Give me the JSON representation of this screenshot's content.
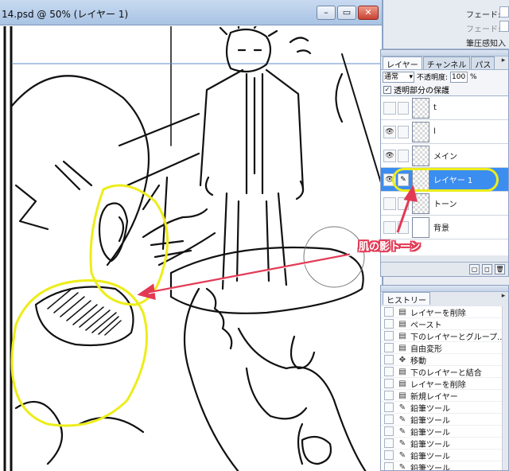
{
  "document": {
    "title": "14.psd @ 50% (レイヤー 1)",
    "buttons": {
      "minimize": "–",
      "restore": "▭",
      "close": "✕"
    }
  },
  "topright": {
    "row1": "フェード:",
    "row2": "フェード:",
    "row3": "筆圧感知入"
  },
  "layers_panel": {
    "tabs": [
      "レイヤー",
      "チャンネル",
      "パス"
    ],
    "blend_mode": "通常",
    "opacity_label": "不透明度:",
    "opacity_value": "100",
    "opacity_unit": "%",
    "preserve_label": "透明部分の保護",
    "layers": [
      {
        "name": "t",
        "visible": false,
        "selected": false
      },
      {
        "name": "l",
        "visible": true,
        "selected": false
      },
      {
        "name": "メイン",
        "visible": true,
        "selected": false
      },
      {
        "name": "レイヤー 1",
        "visible": true,
        "selected": true
      },
      {
        "name": "トーン",
        "visible": false,
        "selected": false
      },
      {
        "name": "背景",
        "visible": false,
        "selected": false
      }
    ]
  },
  "history_panel": {
    "tab": "ヒストリー",
    "items": [
      {
        "label": "レイヤーを削除",
        "icon": "layer-icon"
      },
      {
        "label": "ペースト",
        "icon": "layer-icon"
      },
      {
        "label": "下のレイヤーとグループ...",
        "icon": "layer-icon"
      },
      {
        "label": "自由変形",
        "icon": "layer-icon"
      },
      {
        "label": "移動",
        "icon": "move-icon"
      },
      {
        "label": "下のレイヤーと結合",
        "icon": "layer-icon"
      },
      {
        "label": "レイヤーを削除",
        "icon": "layer-icon"
      },
      {
        "label": "新規レイヤー",
        "icon": "layer-icon"
      },
      {
        "label": "鉛筆ツール",
        "icon": "pencil-icon"
      },
      {
        "label": "鉛筆ツール",
        "icon": "pencil-icon"
      },
      {
        "label": "鉛筆ツール",
        "icon": "pencil-icon"
      },
      {
        "label": "鉛筆ツール",
        "icon": "pencil-icon"
      },
      {
        "label": "鉛筆ツール",
        "icon": "pencil-icon"
      },
      {
        "label": "鉛筆ツール",
        "icon": "pencil-icon"
      }
    ]
  },
  "annotation": {
    "label": "肌の影トーン",
    "color": "#e23a55",
    "highlight_color": "#eded1a"
  }
}
